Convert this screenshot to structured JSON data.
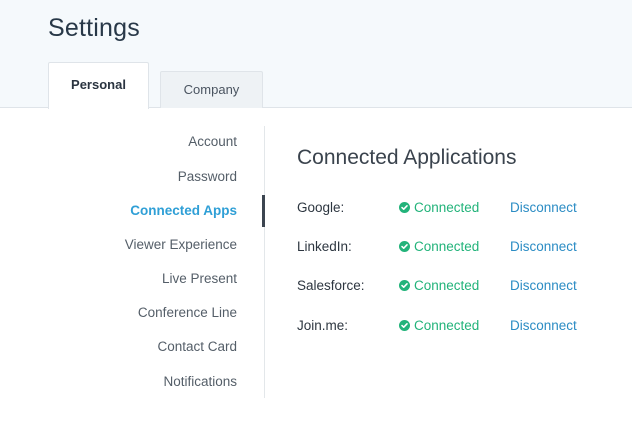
{
  "header": {
    "title": "Settings"
  },
  "tabs": [
    {
      "label": "Personal",
      "active": true
    },
    {
      "label": "Company",
      "active": false
    }
  ],
  "sidebar": {
    "items": [
      {
        "label": "Account"
      },
      {
        "label": "Password"
      },
      {
        "label": "Connected Apps",
        "active": true
      },
      {
        "label": "Viewer Experience"
      },
      {
        "label": "Live Present"
      },
      {
        "label": "Conference Line"
      },
      {
        "label": "Contact Card"
      },
      {
        "label": "Notifications"
      }
    ]
  },
  "main": {
    "title": "Connected Applications",
    "apps": [
      {
        "name": "Google:",
        "status": "Connected",
        "action": "Disconnect"
      },
      {
        "name": "LinkedIn:",
        "status": "Connected",
        "action": "Disconnect"
      },
      {
        "name": "Salesforce:",
        "status": "Connected",
        "action": "Disconnect"
      },
      {
        "name": "Join.me:",
        "status": "Connected",
        "action": "Disconnect"
      }
    ]
  },
  "colors": {
    "accent": "#2f9fd6",
    "connected": "#22b37a",
    "link": "#2b8cc4"
  },
  "icons": {
    "status": "check-circle-icon"
  }
}
